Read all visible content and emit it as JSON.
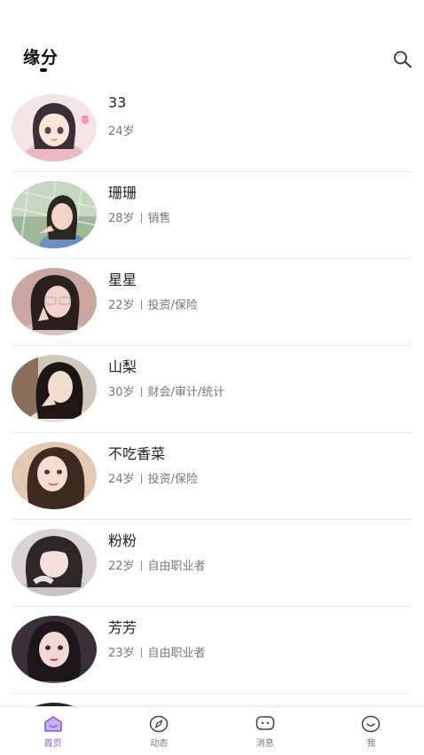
{
  "header": {
    "title": "缘分"
  },
  "colors": {
    "accent": "#8a5cd6",
    "text_primary": "#222222",
    "text_secondary": "#777777",
    "divider": "#ececec"
  },
  "profiles": [
    {
      "name": "33",
      "age": "24岁",
      "job": ""
    },
    {
      "name": "珊珊",
      "age": "28岁",
      "job": "销售"
    },
    {
      "name": "星星",
      "age": "22岁",
      "job": "投资/保险"
    },
    {
      "name": "山梨",
      "age": "30岁",
      "job": "财会/审计/统计"
    },
    {
      "name": "不吃香菜",
      "age": "24岁",
      "job": "投资/保险"
    },
    {
      "name": "粉粉",
      "age": "22岁",
      "job": "自由职业者"
    },
    {
      "name": "芳芳",
      "age": "23岁",
      "job": "自由职业者"
    }
  ],
  "nav": {
    "items": [
      {
        "label": "首页",
        "icon": "home-icon",
        "active": true
      },
      {
        "label": "动态",
        "icon": "compass-icon",
        "active": false
      },
      {
        "label": "消息",
        "icon": "message-icon",
        "active": false
      },
      {
        "label": "我",
        "icon": "smile-icon",
        "active": false
      }
    ]
  }
}
